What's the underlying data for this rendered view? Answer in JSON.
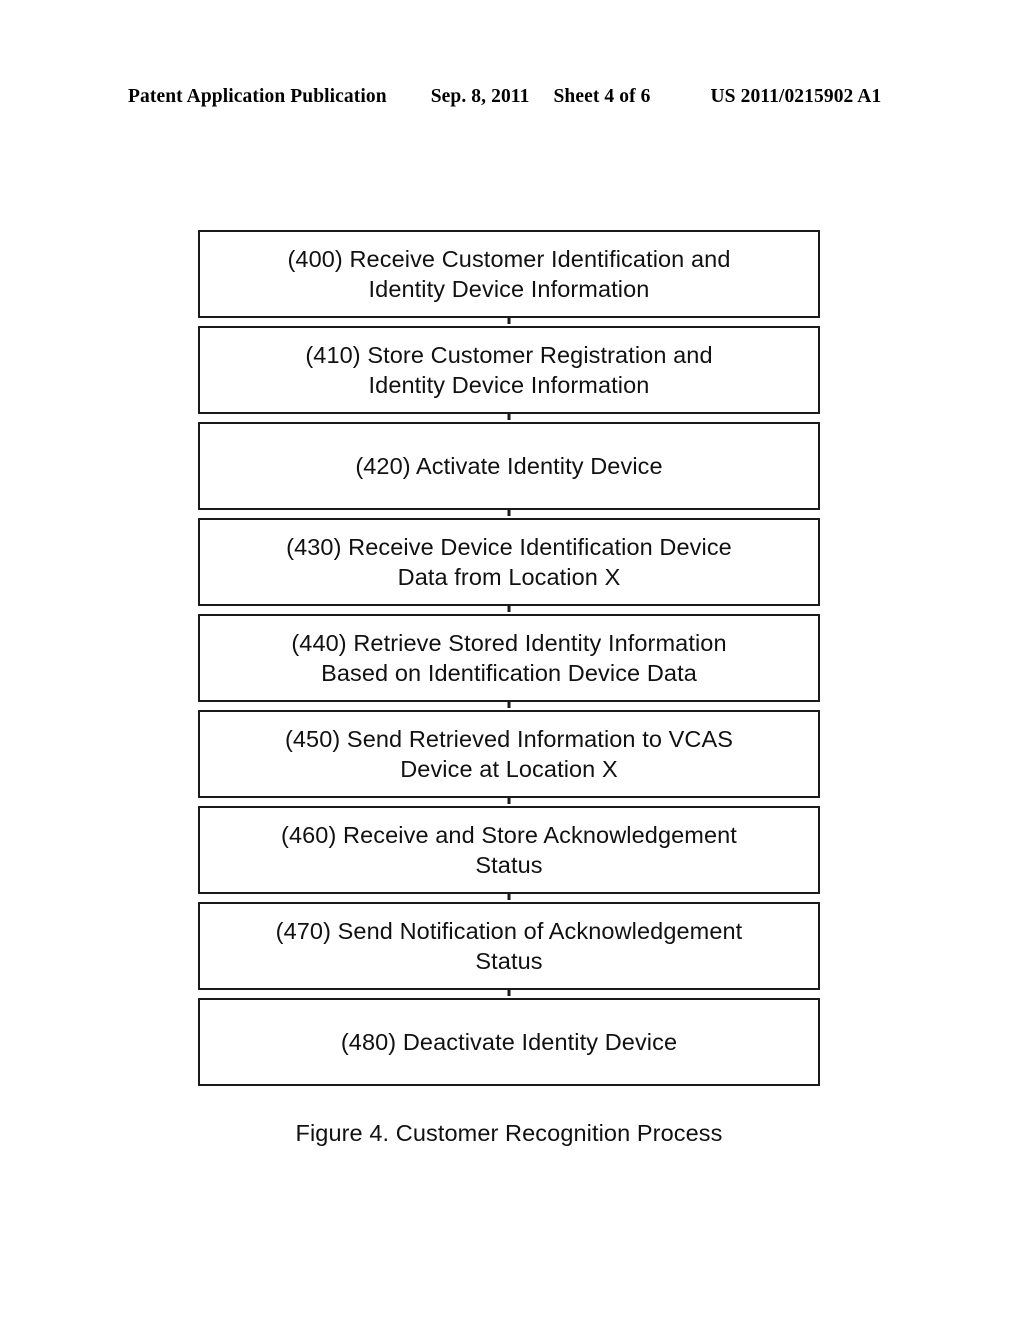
{
  "page": {
    "background_color": "#ffffff",
    "ink_color": "#111111"
  },
  "header": {
    "publication_label": "Patent Application Publication",
    "date": "Sep. 8, 2011",
    "sheet": "Sheet 4 of 6",
    "document_number": "US 2011/0215902 A1"
  },
  "figure": {
    "caption": "Figure 4. Customer Recognition Process",
    "steps": [
      {
        "ref": "400",
        "text": "(400) Receive Customer Identification and\nIdentity Device Information"
      },
      {
        "ref": "410",
        "text": "(410) Store Customer Registration and\nIdentity Device Information"
      },
      {
        "ref": "420",
        "text": "(420) Activate Identity Device"
      },
      {
        "ref": "430",
        "text": "(430) Receive Device Identification Device\nData from Location X"
      },
      {
        "ref": "440",
        "text": "(440) Retrieve Stored Identity Information\nBased on Identification Device Data"
      },
      {
        "ref": "450",
        "text": "(450) Send Retrieved Information to VCAS\nDevice at Location X"
      },
      {
        "ref": "460",
        "text": "(460) Receive and Store Acknowledgement\nStatus"
      },
      {
        "ref": "470",
        "text": "(470) Send Notification of Acknowledgement\nStatus"
      },
      {
        "ref": "480",
        "text": "(480) Deactivate Identity Device"
      }
    ]
  },
  "chart_data": {
    "type": "diagram",
    "diagram_kind": "flowchart",
    "orientation": "vertical",
    "title": "Figure 4. Customer Recognition Process",
    "node_count": 9,
    "nodes": [
      {
        "id": "400",
        "label": "(400) Receive Customer Identification and Identity Device Information"
      },
      {
        "id": "410",
        "label": "(410) Store Customer Registration and Identity Device Information"
      },
      {
        "id": "420",
        "label": "(420) Activate Identity Device"
      },
      {
        "id": "430",
        "label": "(430) Receive Device Identification Device Data from Location X"
      },
      {
        "id": "440",
        "label": "(440) Retrieve Stored Identity Information Based on Identification Device Data"
      },
      {
        "id": "450",
        "label": "(450) Send Retrieved Information to VCAS Device at Location X"
      },
      {
        "id": "460",
        "label": "(460) Receive and Store Acknowledgement Status"
      },
      {
        "id": "470",
        "label": "(470) Send Notification of Acknowledgement Status"
      },
      {
        "id": "480",
        "label": "(480) Deactivate Identity Device"
      }
    ],
    "edges": [
      {
        "from": "400",
        "to": "410"
      },
      {
        "from": "410",
        "to": "420"
      },
      {
        "from": "420",
        "to": "430"
      },
      {
        "from": "430",
        "to": "440"
      },
      {
        "from": "440",
        "to": "450"
      },
      {
        "from": "450",
        "to": "460"
      },
      {
        "from": "460",
        "to": "470"
      },
      {
        "from": "470",
        "to": "480"
      }
    ]
  }
}
